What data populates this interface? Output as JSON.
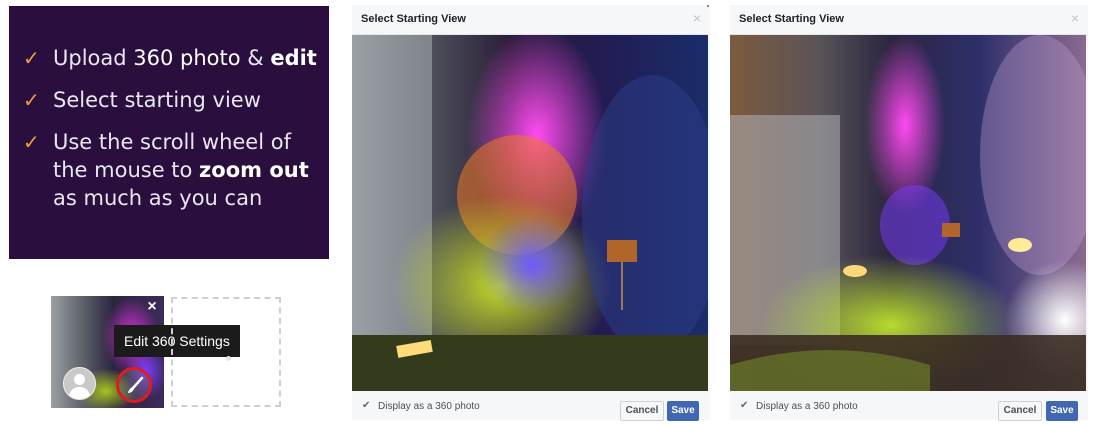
{
  "instructions": {
    "steps": [
      {
        "parts": [
          {
            "text": "Upload ",
            "bold": false
          },
          {
            "text": "360 photo",
            "bold": false,
            "bright": true
          },
          {
            "text": " & ",
            "bold": false
          },
          {
            "text": "edit",
            "bold": true
          }
        ]
      },
      {
        "parts": [
          {
            "text": "Select starting view",
            "bold": false
          }
        ]
      },
      {
        "parts": [
          {
            "text": "Use the scroll wheel of the mouse to ",
            "bold": false
          },
          {
            "text": "zoom out",
            "bold": true
          },
          {
            "text": " as much as you can",
            "bold": false
          }
        ]
      }
    ],
    "check_color": "#f39c3a",
    "background": "#2a0f3e"
  },
  "thumbnail": {
    "tooltip": "Edit 360 Settings",
    "close_glyph": "×",
    "icons": [
      "avatar-icon",
      "brush-icon",
      "close-icon"
    ]
  },
  "dialog_left": {
    "title": "Select Starting View",
    "close_glyph": "×",
    "checkbox_label": "Display as a 360 photo",
    "checkbox_checked": true,
    "cancel_label": "Cancel",
    "save_label": "Save"
  },
  "dialog_right": {
    "title": "Select Starting View",
    "close_glyph": "×",
    "checkbox_label": "Display as a 360 photo",
    "checkbox_checked": true,
    "cancel_label": "Cancel",
    "save_label": "Save"
  },
  "colors": {
    "save_button": "#4267b2",
    "highlight_ring": "#e01b1b"
  }
}
